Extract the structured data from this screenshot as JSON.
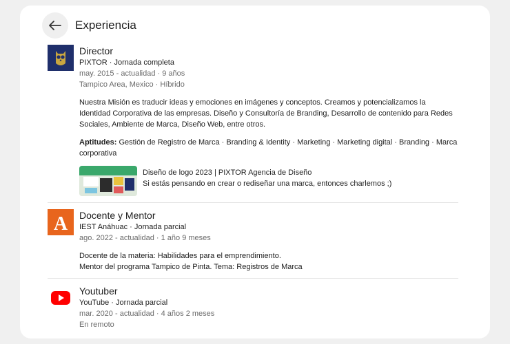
{
  "header": {
    "title": "Experiencia"
  },
  "entries": [
    {
      "role": "Director",
      "company": "PIXTOR · Jornada completa",
      "dates": "may. 2015 - actualidad · 9 años",
      "location": "Tampico Area, Mexico · Híbrido",
      "description": "Nuestra Misión es traducir ideas y emociones en imágenes y conceptos. Creamos y potencializamos la Identidad Corporativa de las empresas. Diseño y Consultoría de Branding, Desarrollo de contenido para Redes Sociales, Ambiente de Marca, Diseño Web, entre otros.",
      "skills_label": "Aptitudes:",
      "skills": "Gestión de Registro de Marca · Branding & Identity · Marketing · Marketing digital · Branding · Marca corporativa",
      "media": {
        "title": "Diseño de logo 2023 | PIXTOR Agencia de Diseño",
        "subtitle": "Si estás pensando en crear o rediseñar una marca, entonces charlemos ;)"
      },
      "logo_icon": "owl-logo-icon",
      "logo_color": "#1f2f6b"
    },
    {
      "role": "Docente y Mentor",
      "company": "IEST Anáhuac · Jornada parcial",
      "dates": "ago. 2022 - actualidad · 1 año 9 meses",
      "description_lines": [
        "Docente de la materia: Habilidades para el emprendimiento.",
        "Mentor del programa Tampico de Pinta. Tema: Registros de Marca"
      ],
      "logo_letter": "A",
      "logo_color": "#e8651d"
    },
    {
      "role": "Youtuber",
      "company": "YouTube · Jornada parcial",
      "dates": "mar. 2020 - actualidad · 4 años 2 meses",
      "location": "En remoto",
      "logo_icon": "youtube-logo-icon",
      "logo_color": "#ff0000"
    }
  ]
}
